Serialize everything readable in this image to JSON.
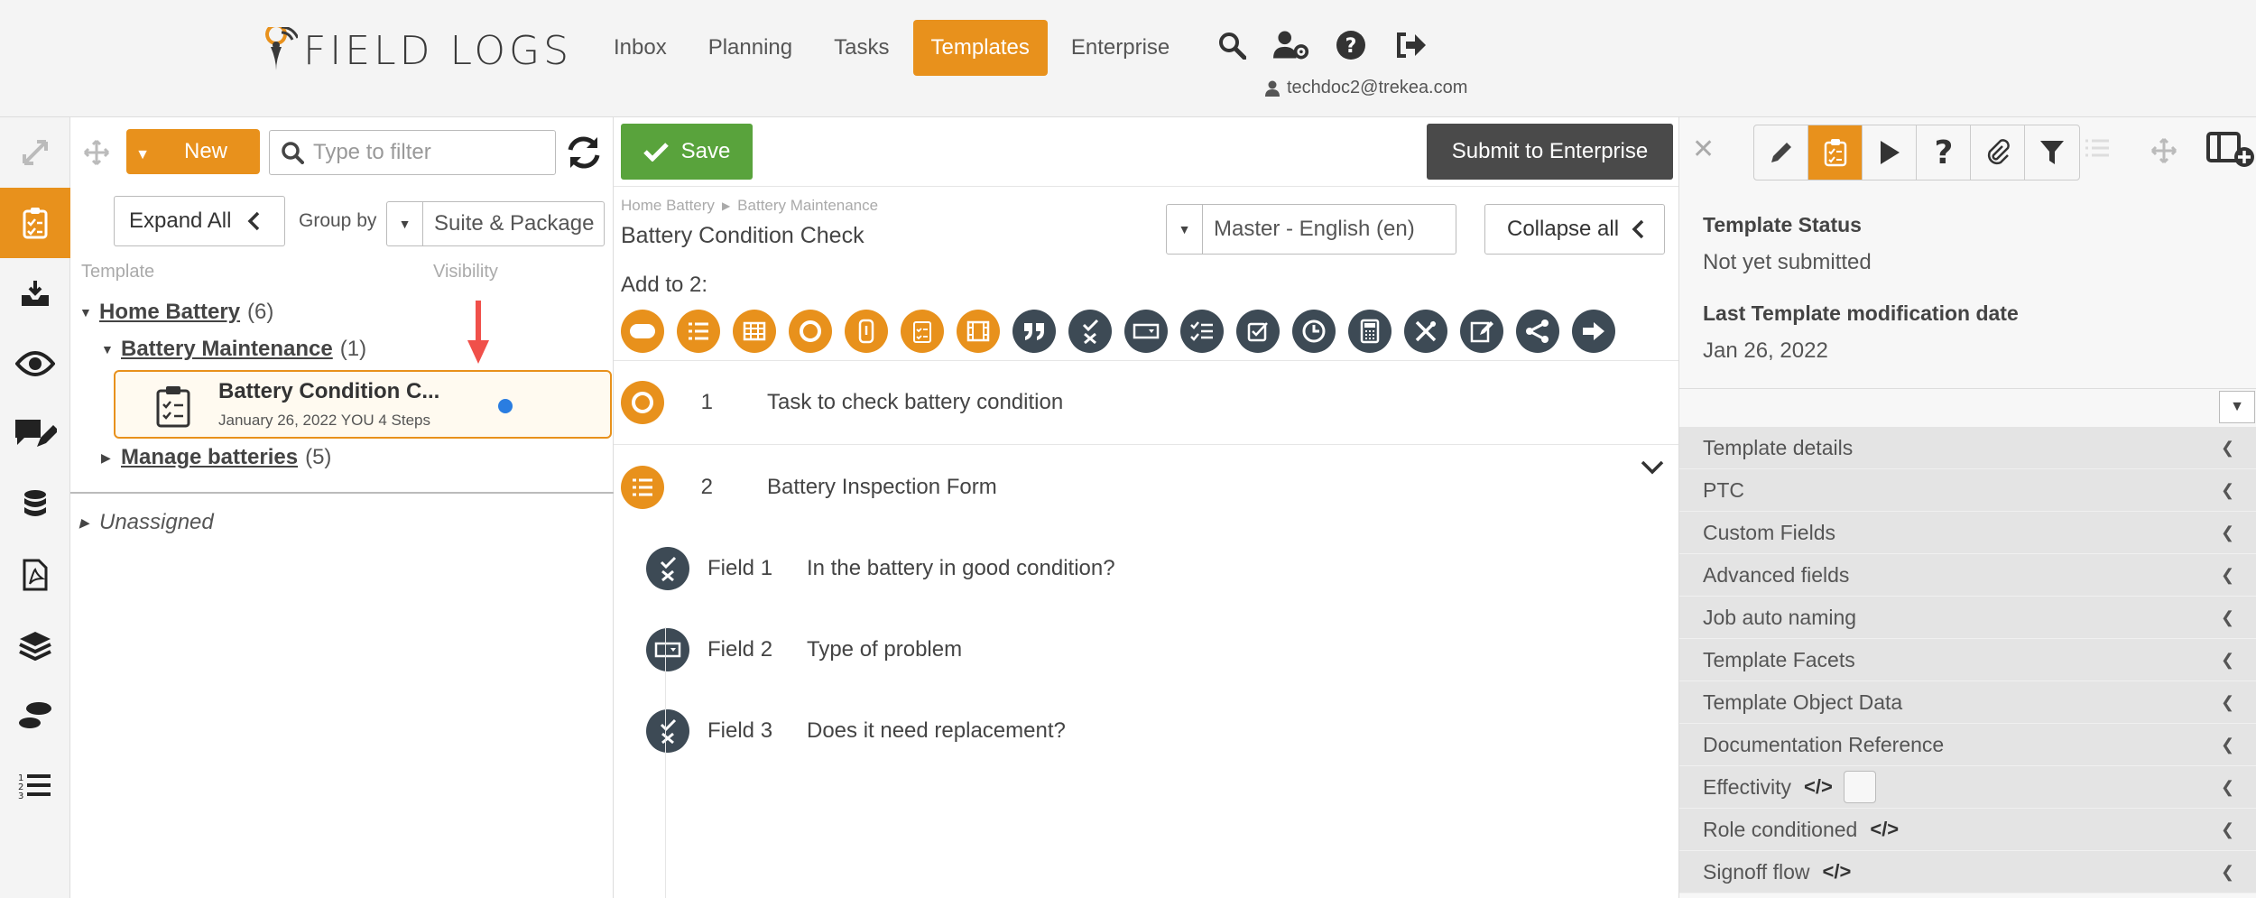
{
  "app": {
    "logo_text": "FIELD LOGS",
    "nav": [
      "Inbox",
      "Planning",
      "Tasks",
      "Templates",
      "Enterprise"
    ],
    "active_nav": "Templates",
    "user": "techdoc2@trekea.com"
  },
  "left": {
    "new_label": "New",
    "filter_placeholder": "Type to filter",
    "expand_all": "Expand All",
    "group_by_label": "Group by",
    "group_by_value": "Suite & Package",
    "col_template": "Template",
    "col_visibility": "Visibility",
    "tree": {
      "home": {
        "name": "Home Battery",
        "count": "(6)"
      },
      "maint": {
        "name": "Battery Maintenance",
        "count": "(1)"
      },
      "card": {
        "title": "Battery Condition C...",
        "meta": "January 26, 2022   YOU   4 Steps"
      },
      "manage": {
        "name": "Manage batteries",
        "count": "(5)"
      },
      "unassigned": "Unassigned"
    }
  },
  "center": {
    "save": "Save",
    "submit": "Submit to Enterprise",
    "breadcrumb": [
      "Home Battery",
      "Battery Maintenance"
    ],
    "title": "Battery Condition Check",
    "language": "Master - English (en)",
    "collapse_all": "Collapse all",
    "add_to": "Add to 2:",
    "steps": [
      {
        "num": "1",
        "title": "Task to check battery condition"
      },
      {
        "num": "2",
        "title": "Battery Inspection Form"
      }
    ],
    "fields": [
      {
        "label": "Field 1",
        "question": "In the battery in good condition?"
      },
      {
        "label": "Field 2",
        "question": "Type of problem"
      },
      {
        "label": "Field 3",
        "question": "Does it need replacement?"
      }
    ]
  },
  "right": {
    "status_h": "Template Status",
    "status_v": "Not yet submitted",
    "mod_h": "Last Template modification date",
    "mod_v": "Jan 26, 2022",
    "accordion": [
      "Template details",
      "PTC",
      "Custom Fields",
      "Advanced fields",
      "Job auto naming",
      "Template Facets",
      "Template Object Data",
      "Documentation Reference",
      "Effectivity",
      "Role conditioned",
      "Signoff flow"
    ],
    "code_symbol": "</>"
  },
  "colors": {
    "accent": "#e8911c",
    "save": "#59a33c",
    "dark": "#3d4a55",
    "info": "#2a7de1"
  }
}
